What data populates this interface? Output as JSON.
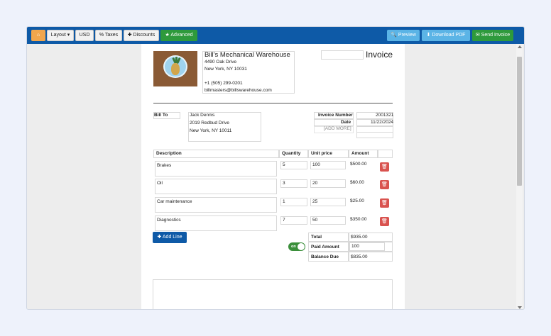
{
  "toolbar": {
    "home_icon": "home-icon",
    "layout_label": "Layout ▾",
    "currency_label": "USD",
    "taxes_label": "% Taxes",
    "discounts_label": "✚ Discounts",
    "advanced_label": "★ Advanced",
    "preview_label": "🔍 Preview",
    "download_label": "⬇ Download PDF",
    "send_label": "✉ Send Invoice"
  },
  "invoice": {
    "title": "Invoice",
    "company": {
      "name": "Bill's Mechanical Warehouse",
      "address1": "4490 Oak Drive",
      "address2": "New York, NY 10031",
      "phone": "+1 (505) 299-0201",
      "email": "billmasters@billswarehouse.com"
    },
    "bill_to": {
      "label": "Bill To",
      "name": "Jack Dennis",
      "address1": "2019 Redbud Drive",
      "address2": "New York, NY 10011"
    },
    "meta": {
      "number_label": "Invoice Number",
      "number_value": "2001321",
      "date_label": "Date",
      "date_value": "11/22/2024",
      "add_more": "[ADD MORE]"
    },
    "columns": {
      "description": "Description",
      "quantity": "Quantity",
      "unit_price": "Unit price",
      "amount": "Amount"
    },
    "lines": [
      {
        "description": "Brakes",
        "quantity": "5",
        "unit_price": "100",
        "amount": "$500.00"
      },
      {
        "description": "Oil",
        "quantity": "3",
        "unit_price": "20",
        "amount": "$60.00"
      },
      {
        "description": "Car maintenance",
        "quantity": "1",
        "unit_price": "25",
        "amount": "$25.00"
      },
      {
        "description": "Diagnostics",
        "quantity": "7",
        "unit_price": "50",
        "amount": "$350.00"
      }
    ],
    "add_line": "✚ Add Line",
    "toggle_label": "on",
    "totals": {
      "total_label": "Total",
      "total_value": "$935.00",
      "paid_label": "Paid Amount",
      "paid_value": "100",
      "balance_label": "Balance Due",
      "balance_value": "$835.00"
    }
  },
  "colors": {
    "toolbar": "#0e5aa7",
    "accent_green": "#2e9a3c",
    "preview_blue": "#5bb4e6",
    "delete_red": "#d9534f",
    "home_orange": "#f0a64d"
  }
}
